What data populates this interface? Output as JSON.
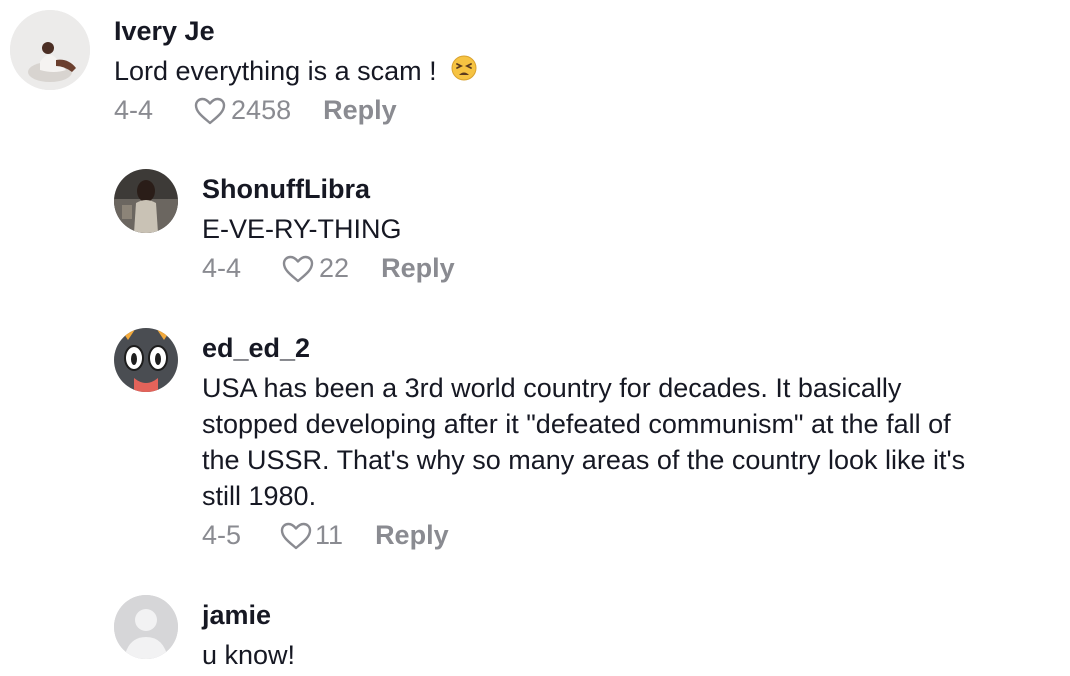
{
  "comments": [
    {
      "username": "Ivery Je",
      "text_lines": [
        "Lord everything is a scam !"
      ],
      "emoji": "tired-face-emoji",
      "date": "4-4",
      "likes": "2458",
      "reply_label": "Reply"
    },
    {
      "username": "ShonuffLibra",
      "text_lines": [
        "E-VE-RY-THING"
      ],
      "date": "4-4",
      "likes": "22",
      "reply_label": "Reply"
    },
    {
      "username": "ed_ed_2",
      "text_lines": [
        "USA has been a 3rd world country for decades. It basically",
        "stopped developing after it \"defeated communism\" at the fall of",
        "the USSR. That's why so many areas of the country look like it's",
        "still 1980."
      ],
      "date": "4-5",
      "likes": "11",
      "reply_label": "Reply"
    },
    {
      "username": "jamie",
      "text_lines": [
        "u know!"
      ]
    }
  ],
  "colors": {
    "text": "#161823",
    "muted": "#8a8b91",
    "background": "#ffffff"
  }
}
